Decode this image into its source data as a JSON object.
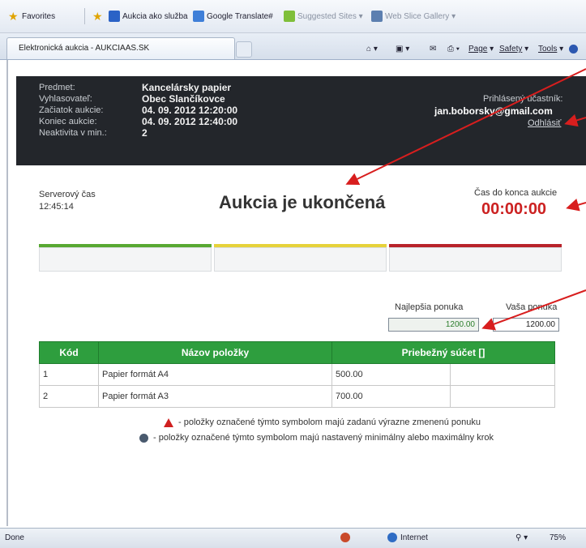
{
  "favorites_bar": {
    "favorites_label": "Favorites",
    "links": [
      "Aukcia ako služba",
      "Google Translate#",
      "Suggested Sites ▾",
      "Web Slice Gallery ▾"
    ]
  },
  "tab": {
    "title": "Elektronická aukcia - AUKCIAAS.SK"
  },
  "command_bar": {
    "page": "Page",
    "safety": "Safety",
    "tools": "Tools"
  },
  "header": {
    "labels": [
      "Predmet:",
      "Vyhlasovateľ:",
      "Začiatok aukcie:",
      "Koniec aukcie:",
      "Neaktivita v min.:"
    ],
    "values": [
      "Kancelársky papier",
      "Obec Slančíkovce",
      "04. 09. 2012 12:20:00",
      "04. 09. 2012 12:40:00",
      "2"
    ],
    "participant_label": "Prihlásený účastník:",
    "participant_email": "jan.boborsky@gmail.com",
    "logout": "Odhlásiť"
  },
  "server_time": {
    "label": "Serverový čas",
    "value": "12:45:14"
  },
  "auction_status": "Aukcia je ukončená",
  "remaining": {
    "label": "Čas do konca aukcie",
    "value": "00:00:00"
  },
  "status_bars": {
    "colors": [
      "#58a832",
      "#e6d23a",
      "#b8232a"
    ]
  },
  "offers": {
    "best_label": "Najlepšia ponuka",
    "best_value": "1200.00",
    "your_label": "Vaša ponuka",
    "your_value": "1200.00"
  },
  "table": {
    "headers": [
      "Kód",
      "Názov položky",
      "Priebežný súčet []"
    ],
    "rows": [
      [
        "1",
        "Papier formát A4",
        "500.00"
      ],
      [
        "2",
        "Papier formát A3",
        "700.00"
      ]
    ]
  },
  "legend": [
    {
      "icon": "warning-triangle-icon",
      "text": "- položky označené týmto symbolom majú zadanú výrazne zmenenú ponuku"
    },
    {
      "icon": "info-dot-icon",
      "text": "- položky označené týmto symbolom majú nastavený minimálny alebo maximálny krok"
    }
  ],
  "statusbar": {
    "done": "Done",
    "zone": "Internet",
    "zoom": "75%"
  }
}
